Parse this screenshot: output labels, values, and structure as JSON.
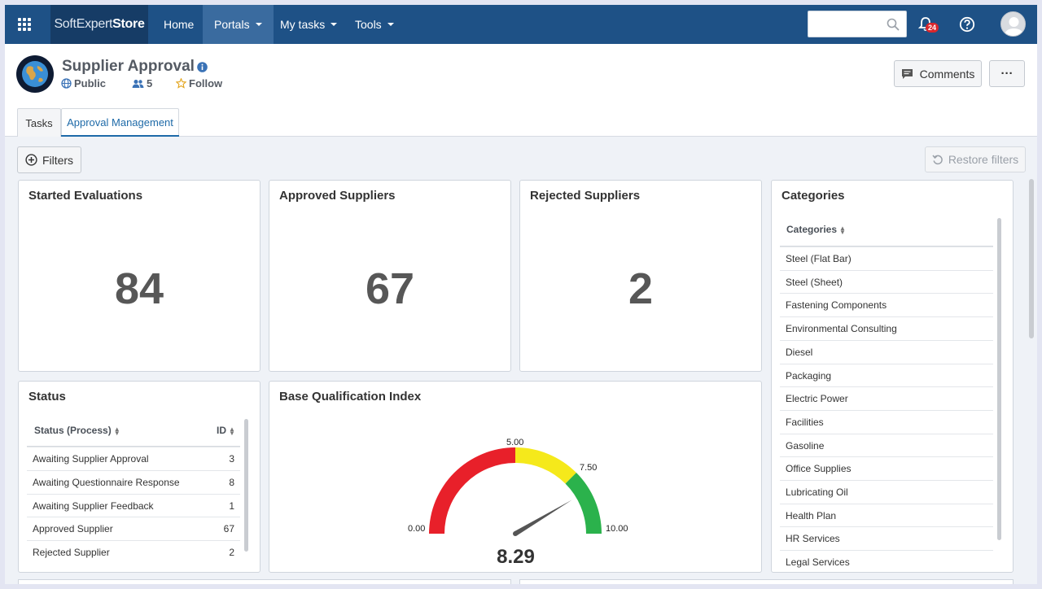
{
  "nav": {
    "brand_soft": "SoftExpert",
    "brand_store": "Store",
    "items": [
      {
        "label": "Home"
      },
      {
        "label": "Portals"
      },
      {
        "label": "My tasks"
      },
      {
        "label": "Tools"
      }
    ],
    "search_placeholder": "",
    "notification_count": "24"
  },
  "header": {
    "title": "Supplier Approval",
    "visibility": "Public",
    "members": "5",
    "follow": "Follow",
    "comments_label": "Comments",
    "more_label": "···"
  },
  "tabs": [
    {
      "label": "Tasks"
    },
    {
      "label": "Approval Management"
    }
  ],
  "toolbar": {
    "filters_label": "Filters",
    "restore_label": "Restore filters"
  },
  "kpis": [
    {
      "title": "Started Evaluations",
      "value": "84"
    },
    {
      "title": "Approved Suppliers",
      "value": "67"
    },
    {
      "title": "Rejected Suppliers",
      "value": "2"
    }
  ],
  "status": {
    "title": "Status",
    "col_status": "Status (Process)",
    "col_id": "ID",
    "rows": [
      {
        "status": "Awaiting Supplier Approval",
        "id": "3"
      },
      {
        "status": "Awaiting Questionnaire Response",
        "id": "8"
      },
      {
        "status": "Awaiting Supplier Feedback",
        "id": "1"
      },
      {
        "status": "Approved Supplier",
        "id": "67"
      },
      {
        "status": "Rejected Supplier",
        "id": "2"
      }
    ]
  },
  "gauge": {
    "title": "Base Qualification Index",
    "min_label": "0.00",
    "mid_label": "5.00",
    "upper_label": "7.50",
    "max_label": "10.00",
    "min": 0,
    "max": 10,
    "value": 8.29,
    "value_label": "8.29",
    "bands": [
      {
        "from": 0,
        "to": 5,
        "color": "#e8202a"
      },
      {
        "from": 5,
        "to": 7.5,
        "color": "#f5e91b"
      },
      {
        "from": 7.5,
        "to": 10,
        "color": "#2bb24c"
      }
    ]
  },
  "categories": {
    "title": "Categories",
    "col_header": "Categories",
    "items": [
      "Steel (Flat Bar)",
      "Steel (Sheet)",
      "Fastening Components",
      "Environmental Consulting",
      "Diesel",
      "Packaging",
      "Electric Power",
      "Facilities",
      "Gasoline",
      "Office Supplies",
      "Lubricating Oil",
      "Health Plan",
      "HR Services",
      "Legal Services"
    ]
  },
  "colors": {
    "nav_bg": "#1e5186",
    "brand_bg": "#163c66",
    "accent": "#1e6aa8",
    "badge": "#d9262c"
  }
}
